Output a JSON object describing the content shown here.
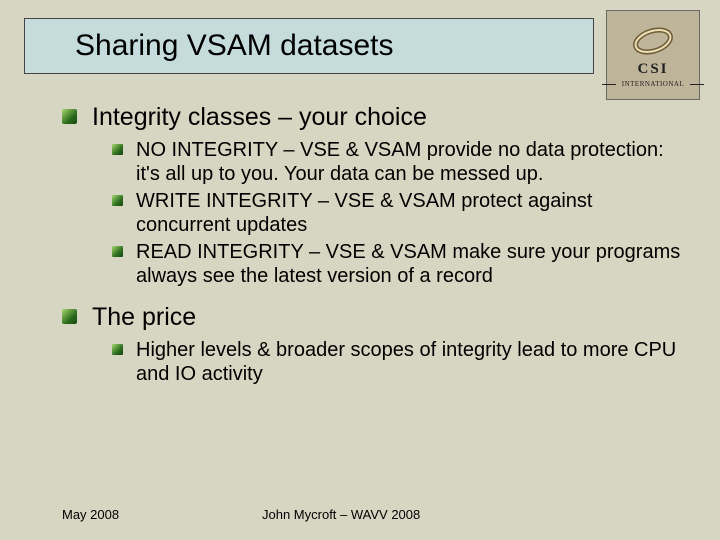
{
  "title": "Sharing VSAM datasets",
  "logo": {
    "line1": "CSI",
    "line2": "INTERNATIONAL"
  },
  "content": {
    "items": [
      {
        "label": "Integrity classes – your choice",
        "children": [
          "NO INTEGRITY – VSE & VSAM provide no data protection: it's all up to you.  Your data can be messed up.",
          "WRITE INTEGRITY – VSE & VSAM protect against concurrent updates",
          "READ INTEGRITY – VSE & VSAM make sure your programs always see the latest version of a record"
        ]
      },
      {
        "label": "The price",
        "children": [
          "Higher levels & broader scopes of integrity lead to more CPU and IO activity"
        ]
      }
    ]
  },
  "footer": {
    "left": "May 2008",
    "center": "John Mycroft – WAVV 2008"
  }
}
